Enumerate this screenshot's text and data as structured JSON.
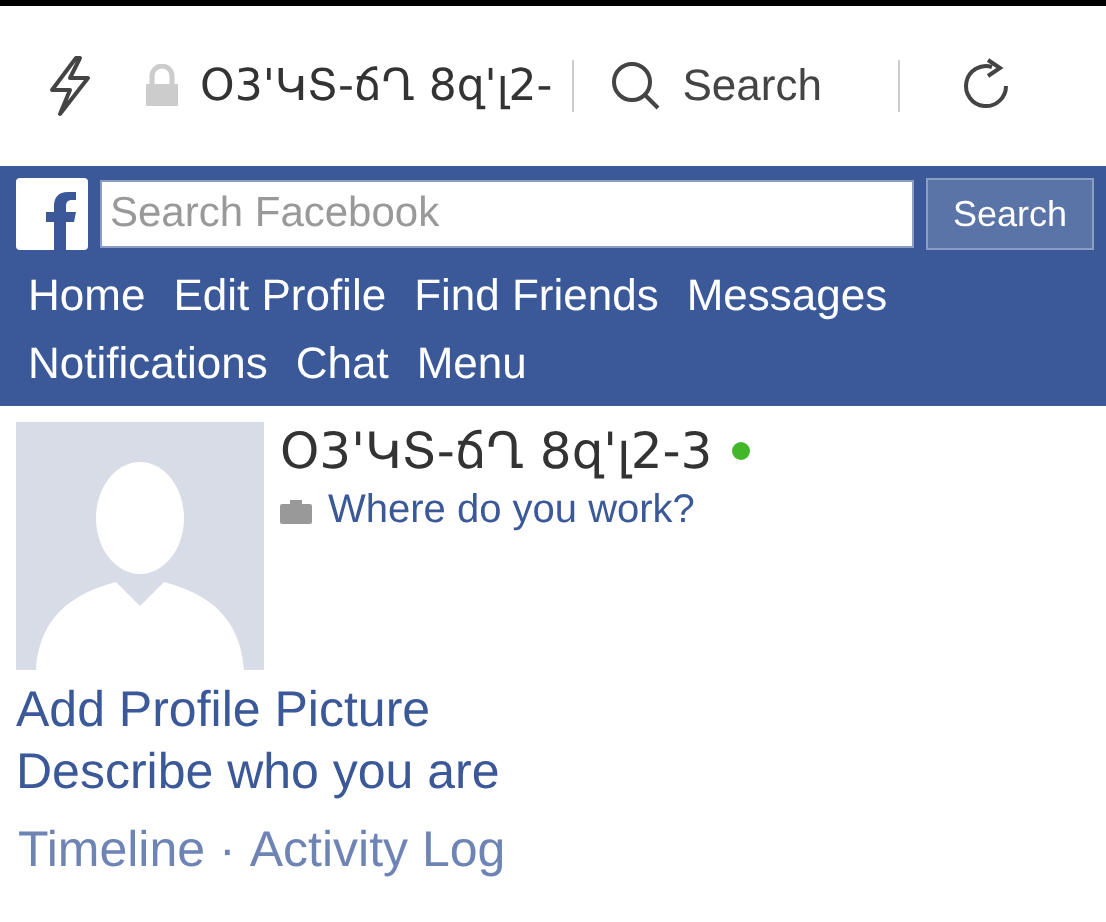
{
  "browser_bar": {
    "address": "Օ3'ԿՏ-ճՂ 8զ'լ2-",
    "search": "Search"
  },
  "header": {
    "search": {
      "placeholder": "Search Facebook",
      "button": "Search"
    },
    "nav": [
      "Home",
      "Edit Profile",
      "Find Friends",
      "Messages",
      "Notifications",
      "Chat",
      "Menu"
    ]
  },
  "profile": {
    "name": "Օ3'ԿՏ-ճՂ 8զ'լ2-3",
    "online": true,
    "work_prompt": "Where do you work?",
    "links": [
      "Add Profile Picture",
      "Describe who you are"
    ],
    "tabs": [
      "Timeline",
      "·",
      "Activity Log"
    ]
  }
}
